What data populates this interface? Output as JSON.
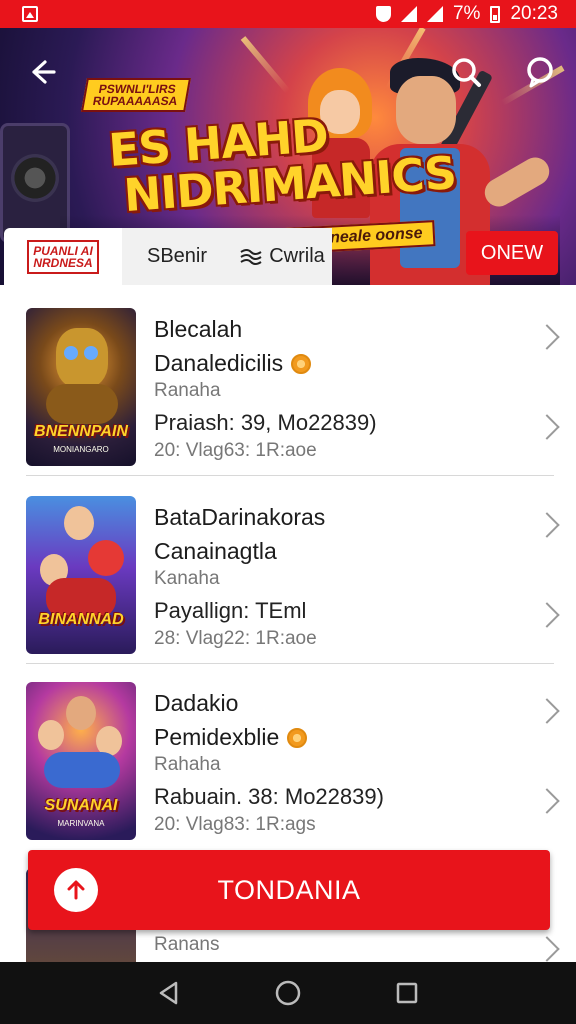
{
  "status_bar": {
    "battery": "7%",
    "time": "20:23"
  },
  "hero": {
    "logo_badge_line1": "PSWNLI'LIRS",
    "logo_badge_line2": "RUPAAAAASA",
    "title_line1": "ES HAHD",
    "title_line2": "NIDRIMANICS",
    "subtitle": "Conmynrain Bioucn No neale oonse",
    "tabs": {
      "tab1_logo_line1": "PUANLI AI",
      "tab1_logo_line2": "NRDNESA",
      "tab2": "SBenir",
      "tab3": "Cwrila",
      "new_button": "ONEW"
    }
  },
  "items": [
    {
      "title": "Blecalah",
      "subtitle": "Danaledicilis",
      "meta1": "Ranaha",
      "meta2": "Praiash: 39, Mo22839)",
      "meta3": "20: Vlag63: 1R:aoe",
      "has_coin": true,
      "thumb_caption": "BNENNPAIN",
      "thumb_sub": "MONIANGARO"
    },
    {
      "title": "BataDarinakoras",
      "subtitle": "Canainagtla",
      "meta1": "Kanaha",
      "meta2": "Payallign: TEml",
      "meta3": "28: Vlag22: 1R:aoe",
      "has_coin": false,
      "thumb_caption": "BINANNAD",
      "thumb_sub": ""
    },
    {
      "title": "Dadakio",
      "subtitle": "Pemidexblie",
      "meta1": "Rahaha",
      "meta2": "Rabuain. 38: Mo22839)",
      "meta3": "20: Vlag83: 1R:ags",
      "has_coin": true,
      "thumb_caption": "SUNANAI",
      "thumb_sub": "MARINVANA"
    },
    {
      "title": "",
      "subtitle": "",
      "meta1": "Ranans",
      "meta2": "",
      "meta3": "",
      "has_coin": false,
      "thumb_caption": "",
      "thumb_sub": ""
    }
  ],
  "fab": {
    "label": "TONDANIA",
    "icon": "arrow-up-icon"
  },
  "colors": {
    "accent": "#e8141b",
    "nav_bar": "#111111"
  }
}
